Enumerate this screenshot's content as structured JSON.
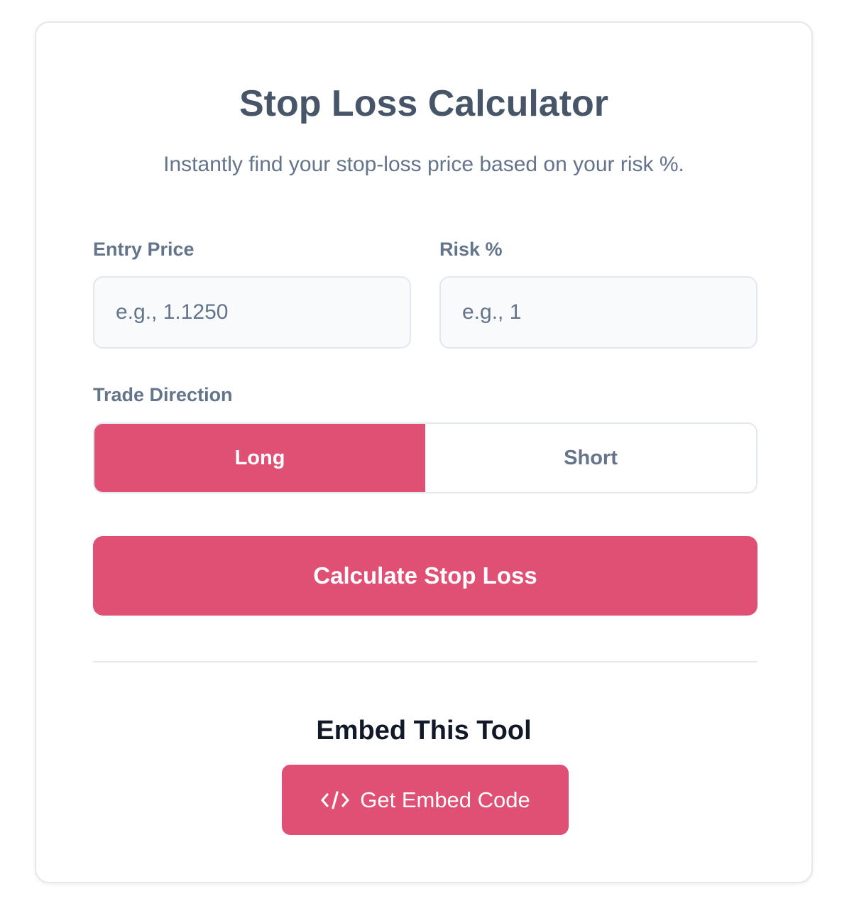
{
  "header": {
    "title": "Stop Loss Calculator",
    "subtitle": "Instantly find your stop-loss price based on your risk %."
  },
  "form": {
    "entry_price": {
      "label": "Entry Price",
      "value": "",
      "placeholder": "e.g., 1.1250"
    },
    "risk": {
      "label": "Risk %",
      "value": "",
      "placeholder": "e.g., 1"
    },
    "direction": {
      "label": "Trade Direction",
      "options": [
        "Long",
        "Short"
      ],
      "selected": "Long"
    },
    "calculate_label": "Calculate Stop Loss"
  },
  "embed": {
    "title": "Embed This Tool",
    "button_label": "Get Embed Code",
    "button_icon": "code-icon"
  },
  "colors": {
    "accent": "#e05074",
    "title": "#475569",
    "muted": "#64748b"
  }
}
